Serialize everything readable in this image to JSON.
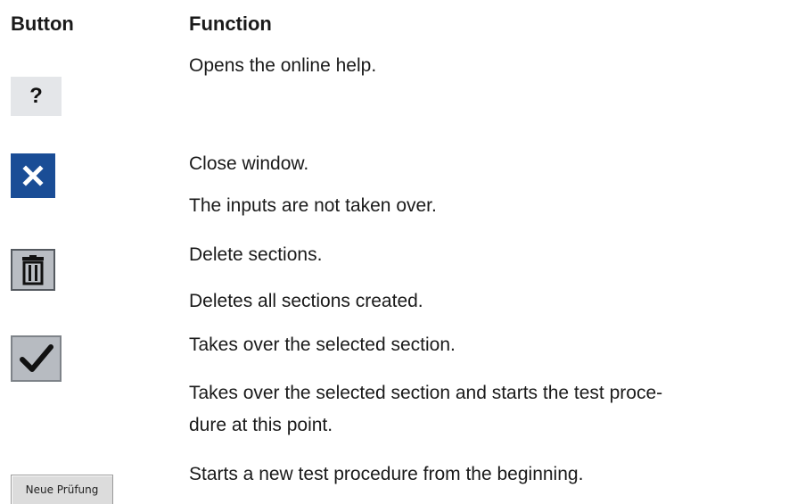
{
  "header": {
    "button_col": "Button",
    "function_col": "Function"
  },
  "rows": [
    {
      "icon": "question-mark-icon",
      "glyph": "?",
      "lines": [
        "Opens the online help."
      ]
    },
    {
      "icon": "close-icon",
      "lines": [
        "Close window.",
        "The inputs are not taken over."
      ]
    },
    {
      "icon": "trash-icon",
      "lines": [
        "Delete sections.",
        "Deletes all sections created."
      ]
    },
    {
      "icon": "checkmark-icon",
      "lines": [
        "Takes over the selected section.",
        "Takes over the selected section and starts the test proce-",
        "dure at this point."
      ]
    },
    {
      "icon": "new-test-button",
      "button_label": "Neue Prüfung",
      "lines": [
        "Starts a new test procedure from the beginning."
      ]
    }
  ],
  "colors": {
    "close_button_bg": "#1a4d96",
    "help_button_bg": "#e4e6e9",
    "toolbar_button_bg": "#b9bdc3"
  }
}
